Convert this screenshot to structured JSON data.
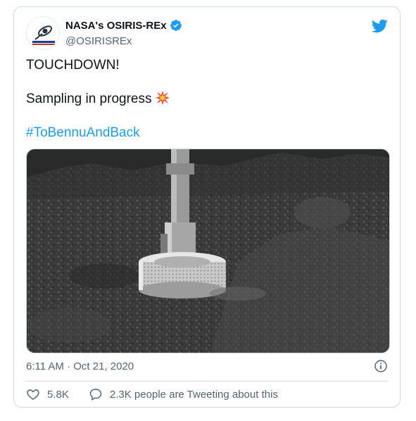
{
  "tweet": {
    "author_name": "NASA's OSIRIS-REx",
    "handle": "@OSIRISREx",
    "avatar_text": "OSIRIS-REX",
    "line1": "TOUCHDOWN!",
    "line2": "Sampling in progress",
    "hashtag": "#ToBennuAndBack",
    "timestamp": "6:11 AM · Oct 21, 2020",
    "likes": "5.8K",
    "replies_text": "2.3K people are Tweeting about this"
  },
  "colors": {
    "accent": "#1d9bf0",
    "text": "#0f1419",
    "muted": "#536471",
    "border": "#cfd9de"
  },
  "icons": {
    "bird": "twitter-bird-icon",
    "verified": "verified-badge-icon",
    "emoji": "collision-emoji-icon",
    "info": "info-icon",
    "like": "heart-icon",
    "reply": "speech-bubble-icon"
  }
}
